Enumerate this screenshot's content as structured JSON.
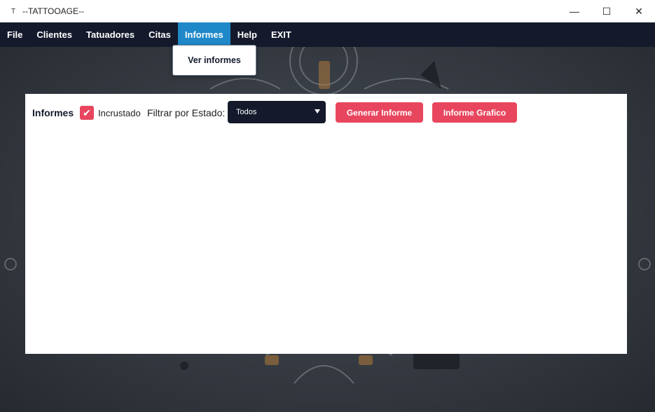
{
  "window": {
    "title": "--TATTOOAGE--",
    "app_icon": "T",
    "controls": {
      "minimize": "—",
      "maximize": "☐",
      "close": "✕"
    }
  },
  "menu": {
    "items": [
      {
        "label": "File",
        "active": false
      },
      {
        "label": "Clientes",
        "active": false
      },
      {
        "label": "Tatuadores",
        "active": false
      },
      {
        "label": "Citas",
        "active": false
      },
      {
        "label": "Informes",
        "active": true
      },
      {
        "label": "Help",
        "active": false
      },
      {
        "label": "EXIT",
        "active": false
      }
    ],
    "dropdown": {
      "items": [
        "Ver informes"
      ]
    }
  },
  "panel": {
    "title": "Informes",
    "checkbox": {
      "label": "Incrustado",
      "checked": true,
      "icon": "check-icon"
    },
    "filter_label": "Filtrar por Estado:",
    "filter_select": {
      "value": "Todos",
      "icon": "caret-down-icon"
    },
    "buttons": {
      "generar": "Generar Informe",
      "grafico": "Informe Grafico"
    }
  },
  "colors": {
    "menubar": "#141a2c",
    "menu_active": "#1e88c8",
    "accent": "#e8465e",
    "select_bg": "#141a2c"
  }
}
